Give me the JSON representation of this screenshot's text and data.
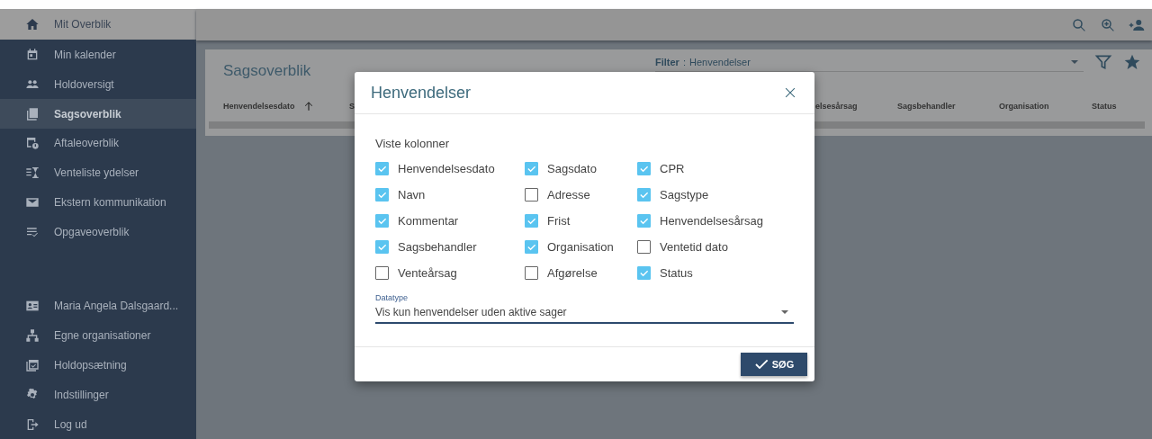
{
  "sidebar": {
    "header": {
      "label": "Mit Overblik"
    },
    "items": [
      {
        "label": "Min kalender",
        "selected": false
      },
      {
        "label": "Holdoversigt",
        "selected": false
      },
      {
        "label": "Sagsoverblik",
        "selected": true
      },
      {
        "label": "Aftaleoverblik",
        "selected": false
      },
      {
        "label": "Venteliste ydelser",
        "selected": false
      },
      {
        "label": "Ekstern kommunikation",
        "selected": false
      },
      {
        "label": "Opgaveoverblik",
        "selected": false
      }
    ],
    "bottom_items": [
      {
        "label": "Maria Angela Dalsgaard..."
      },
      {
        "label": "Egne organisationer"
      },
      {
        "label": "Holdopsætning"
      },
      {
        "label": "Indstillinger"
      },
      {
        "label": "Log ud"
      }
    ]
  },
  "page": {
    "title": "Sagsoverblik",
    "filter": {
      "label": "Filter",
      "separator": ":",
      "value": "Henvendelser"
    },
    "table": {
      "columns": [
        "Henvendelsesdato",
        "S",
        "elsesårsag",
        "Sagsbehandler",
        "Organisation",
        "Status"
      ]
    }
  },
  "dialog": {
    "title": "Henvendelser",
    "section_label": "Viste kolonner",
    "options": [
      {
        "label": "Henvendelsesdato",
        "checked": true
      },
      {
        "label": "Sagsdato",
        "checked": true
      },
      {
        "label": "CPR",
        "checked": true
      },
      {
        "label": "Navn",
        "checked": true
      },
      {
        "label": "Adresse",
        "checked": false
      },
      {
        "label": "Sagstype",
        "checked": true
      },
      {
        "label": "Kommentar",
        "checked": true
      },
      {
        "label": "Frist",
        "checked": true
      },
      {
        "label": "Henvendelsesårsag",
        "checked": true
      },
      {
        "label": "Sagsbehandler",
        "checked": true
      },
      {
        "label": "Organisation",
        "checked": true
      },
      {
        "label": "Ventetid dato",
        "checked": false
      },
      {
        "label": "Venteårsag",
        "checked": false
      },
      {
        "label": "Afgørelse",
        "checked": false
      },
      {
        "label": "Status",
        "checked": true
      }
    ],
    "datatype": {
      "label": "Datatype",
      "value": "Vis kun henvendelser uden aktive sager"
    },
    "button": "SØG"
  }
}
